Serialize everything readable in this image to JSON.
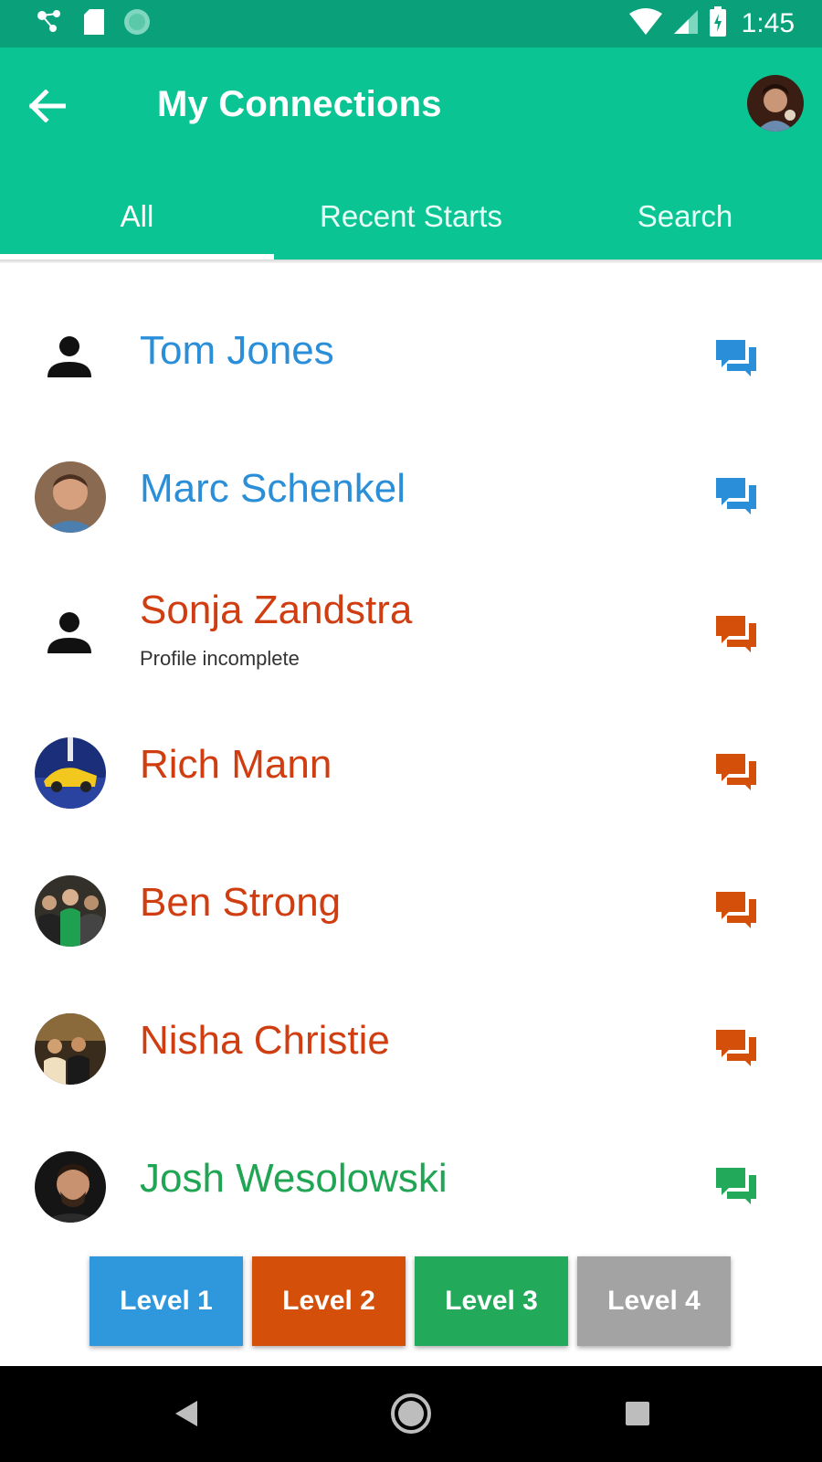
{
  "status_bar": {
    "time": "1:45"
  },
  "app_bar": {
    "title": "My Connections"
  },
  "tabs": [
    {
      "label": "All",
      "active": true
    },
    {
      "label": "Recent Starts",
      "active": false
    },
    {
      "label": "Search",
      "active": false
    }
  ],
  "connections": [
    {
      "name": "Tom Jones",
      "subtitle": "",
      "level": 1,
      "color": "#2a8fd8",
      "avatar": "generic-person-icon"
    },
    {
      "name": "Marc Schenkel",
      "subtitle": "",
      "level": 1,
      "color": "#2a8fd8",
      "avatar": "photo"
    },
    {
      "name": "Sonja Zandstra",
      "subtitle": "Profile incomplete",
      "level": 2,
      "color": "#cf3d10",
      "avatar": "generic-person-icon"
    },
    {
      "name": "Rich Mann",
      "subtitle": "",
      "level": 2,
      "color": "#cf3d10",
      "avatar": "photo"
    },
    {
      "name": "Ben Strong",
      "subtitle": "",
      "level": 2,
      "color": "#cf3d10",
      "avatar": "photo"
    },
    {
      "name": "Nisha Christie",
      "subtitle": "",
      "level": 2,
      "color": "#cf3d10",
      "avatar": "photo"
    },
    {
      "name": "Josh Wesolowski",
      "subtitle": "",
      "level": 3,
      "color": "#1fa553",
      "avatar": "photo"
    }
  ],
  "levels": [
    {
      "label": "Level 1",
      "color": "#2f97dc"
    },
    {
      "label": "Level 2",
      "color": "#d4500a"
    },
    {
      "label": "Level 3",
      "color": "#22aa5a"
    },
    {
      "label": "Level 4",
      "color": "#a3a3a3"
    }
  ],
  "colors": {
    "status_bar": "#0aa17a",
    "app_bar": "#0bc493",
    "level_1_text": "#2a8fd8",
    "level_2_text": "#cf3d10",
    "level_3_text": "#1fa553"
  }
}
